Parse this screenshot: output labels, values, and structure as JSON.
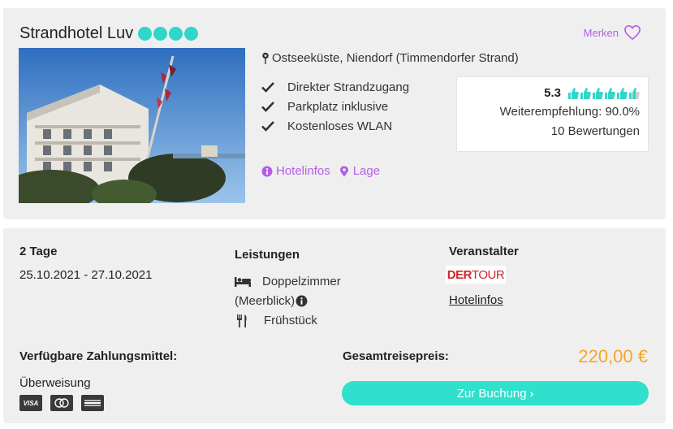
{
  "hotel": {
    "name": "Strandhotel Luv",
    "stars": 4,
    "merken_label": "Merken",
    "location": "Ostseeküste, Niendorf (Timmendorfer Strand)",
    "features": [
      "Direkter Strandzugang",
      "Parkplatz inklusive",
      "Kostenloses WLAN"
    ],
    "rating": {
      "score": "5.3",
      "thumbs_total": 6,
      "recommendation": "Weiterempfehlung: 90.0%",
      "reviews": "10 Bewertungen"
    },
    "links": {
      "hotelinfos": "Hotelinfos",
      "lage": "Lage"
    }
  },
  "offer": {
    "duration": "2 Tage",
    "dates": "25.10.2021 - 27.10.2021",
    "services_title": "Leistungen",
    "room_line1": "Doppelzimmer",
    "room_line2": "(Meerblick)",
    "board": "Frühstück",
    "operator_title": "Veranstalter",
    "operator_logo_der": "DER",
    "operator_logo_tour": "TOUR",
    "operator_link": "Hotelinfos",
    "payment_title": "Verfügbare Zahlungsmittel:",
    "payment_method": "Überweisung",
    "total_label": "Gesamtreisepreis:",
    "price": "220,00 €",
    "book_label": "Zur Buchung"
  },
  "colors": {
    "accent_purple": "#b35ee8",
    "star_teal": "#2fd6c9",
    "button_teal": "#2fe0cc",
    "price_orange": "#f5a623",
    "brand_red": "#d2232a"
  }
}
